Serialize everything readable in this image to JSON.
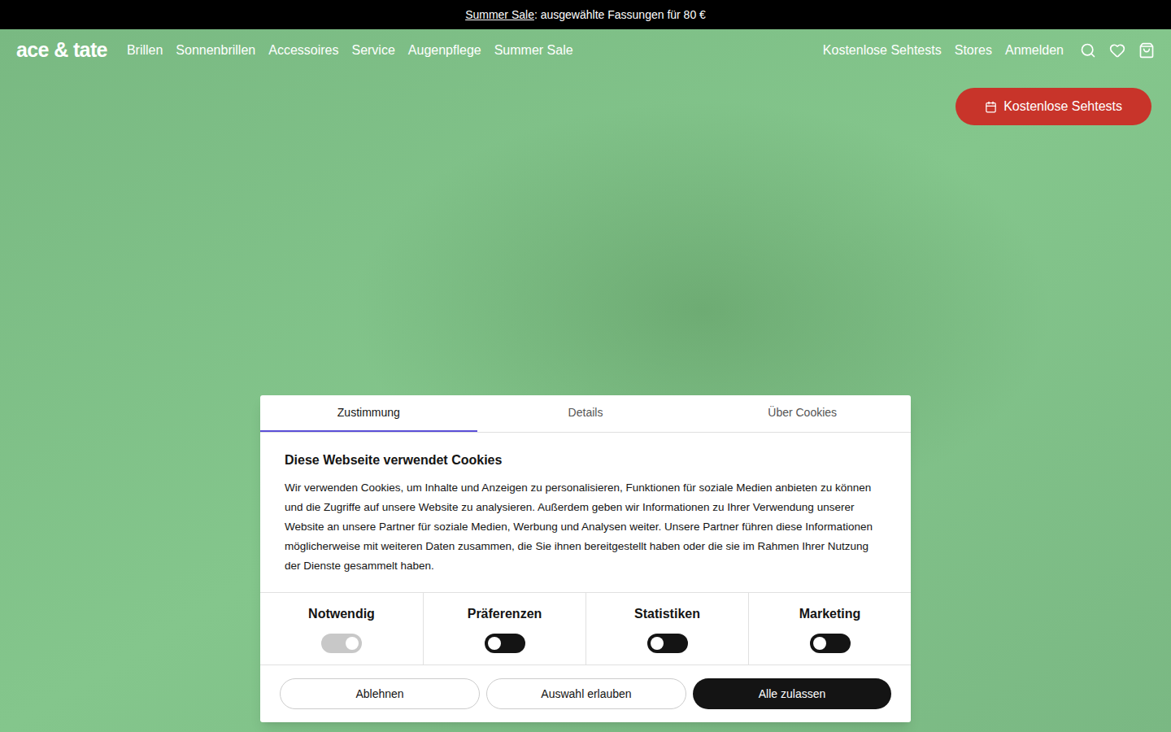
{
  "banner": {
    "link": "Summer Sale",
    "text": ": ausgewählte Fassungen für 80 €"
  },
  "nav": {
    "logo": "ace & tate",
    "items": [
      "Brillen",
      "Sonnenbrillen",
      "Accessoires",
      "Service",
      "Augenpflege",
      "Summer Sale"
    ],
    "right_items": [
      "Kostenlose Sehtests",
      "Stores",
      "Anmelden"
    ]
  },
  "cta": {
    "label": "Kostenlose Sehtests"
  },
  "cookie_dialog": {
    "tabs": [
      {
        "label": "Zustimmung",
        "selected": true
      },
      {
        "label": "Details",
        "selected": false
      },
      {
        "label": "Über Cookies",
        "selected": false
      }
    ],
    "title": "Diese Webseite verwendet Cookies",
    "body": "Wir verwenden Cookies, um Inhalte und Anzeigen zu personalisieren, Funktionen für soziale Medien anbieten zu können und die Zugriffe auf unsere Website zu analysieren. Außerdem geben wir Informationen zu Ihrer Verwendung unserer Website an unsere Partner für soziale Medien, Werbung und Analysen weiter. Unsere Partner führen diese Informationen möglicherweise mit weiteren Daten zusammen, die Sie ihnen bereitgestellt haben oder die sie im Rahmen Ihrer Nutzung der Dienste gesammelt haben.",
    "toggles": [
      {
        "label": "Notwendig",
        "on": true,
        "disabled": true
      },
      {
        "label": "Präferenzen",
        "on": false,
        "disabled": false
      },
      {
        "label": "Statistiken",
        "on": false,
        "disabled": false
      },
      {
        "label": "Marketing",
        "on": false,
        "disabled": false
      }
    ],
    "buttons": [
      {
        "label": "Ablehnen",
        "primary": false
      },
      {
        "label": "Auswahl erlauben",
        "primary": false
      },
      {
        "label": "Alle zulassen",
        "primary": true
      }
    ]
  }
}
